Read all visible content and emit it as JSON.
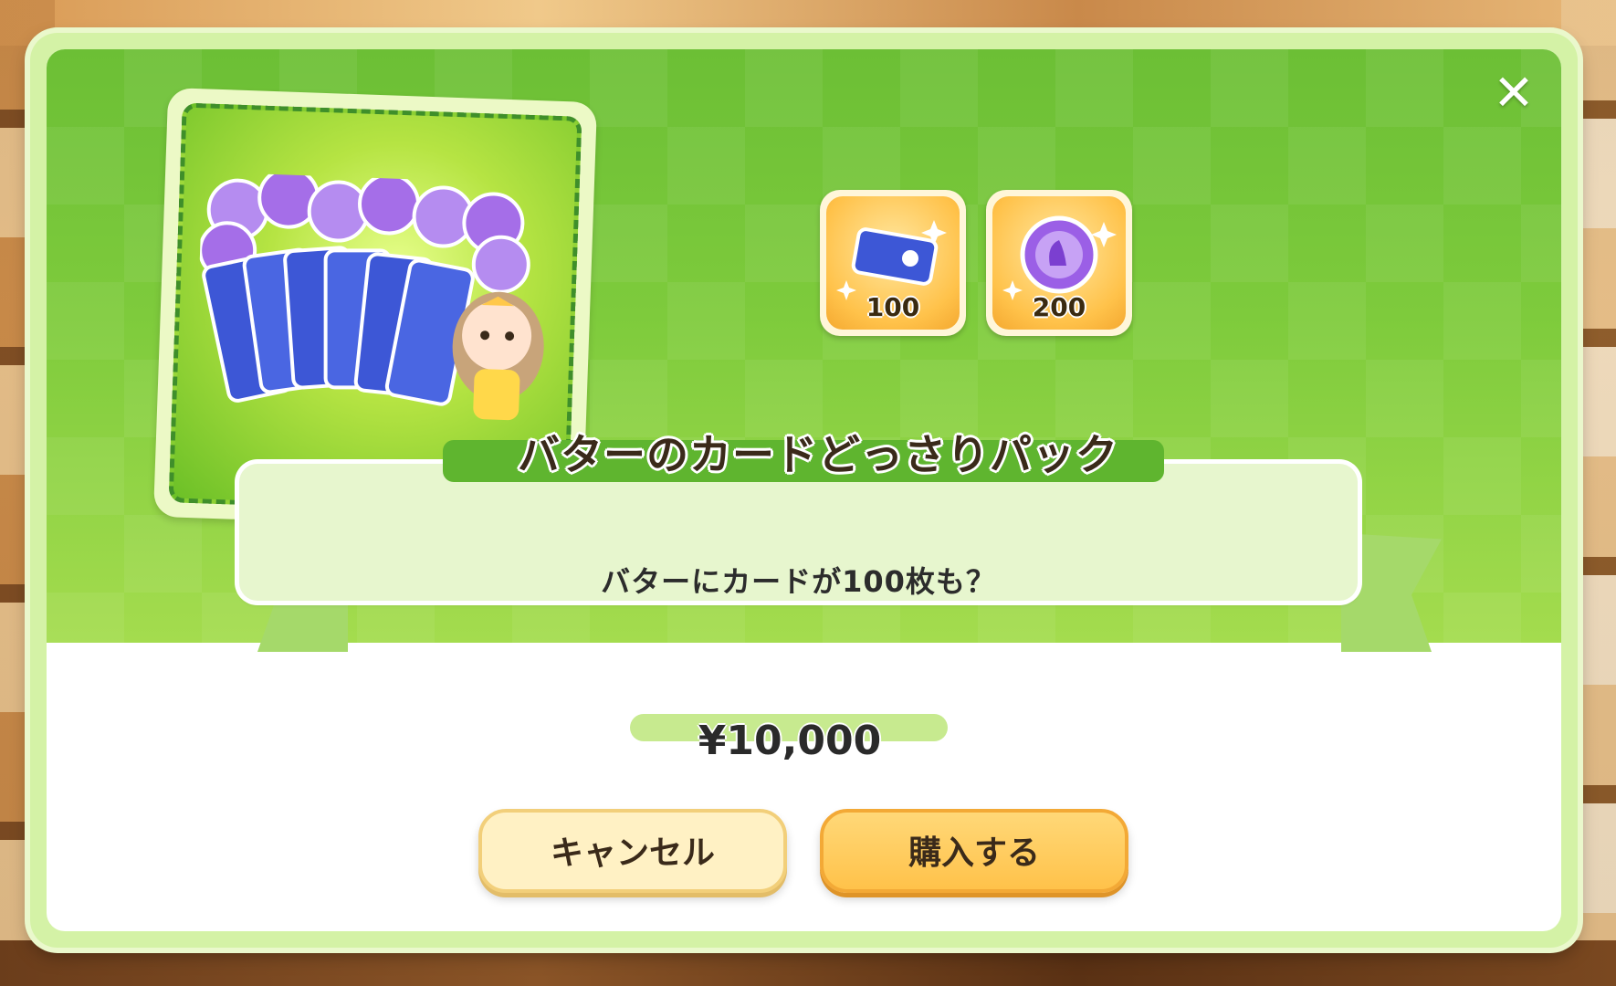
{
  "dialog": {
    "title": "バターのカードどっさりパック",
    "description": "バターにカードが100枚も？",
    "price": "¥10,000",
    "rewards": [
      {
        "icon": "card-ticket-icon",
        "count": "100"
      },
      {
        "icon": "purple-medal-icon",
        "count": "200"
      }
    ],
    "cancel_label": "キャンセル",
    "buy_label": "購入する",
    "close_icon": "close-icon"
  },
  "colors": {
    "accent_green": "#7ecb3c",
    "button_gold": "#ffc24a",
    "ribbon": "#e7f6ce"
  }
}
